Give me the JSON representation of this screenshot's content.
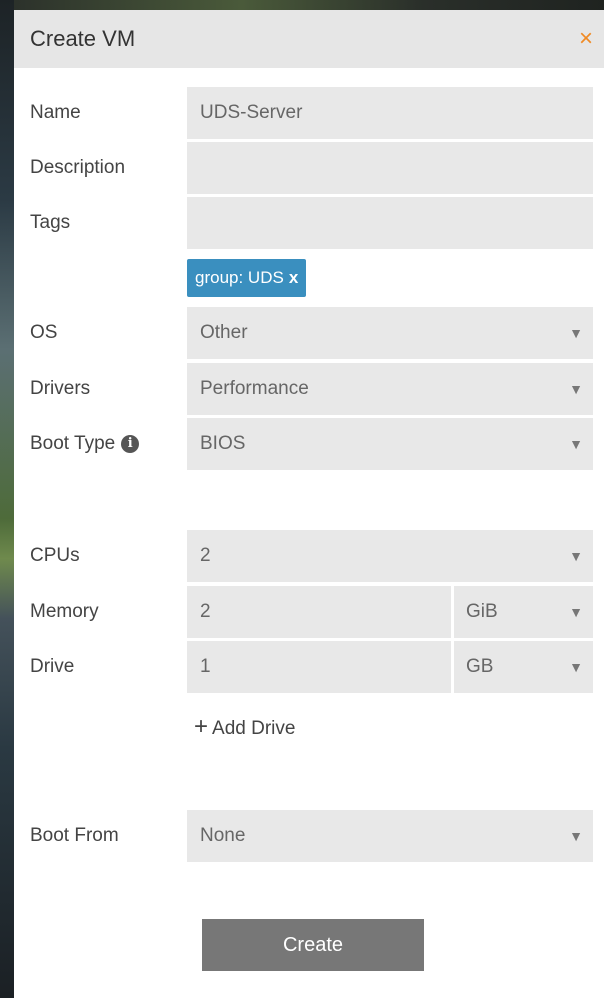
{
  "modal": {
    "title": "Create VM",
    "close_symbol": "×"
  },
  "fields": {
    "name": {
      "label": "Name",
      "value": "UDS-Server"
    },
    "description": {
      "label": "Description",
      "value": ""
    },
    "tags": {
      "label": "Tags",
      "value": "",
      "chips": [
        {
          "text": "group: UDS",
          "remove": "x"
        }
      ]
    },
    "os": {
      "label": "OS",
      "value": "Other"
    },
    "drivers": {
      "label": "Drivers",
      "value": "Performance"
    },
    "boot_type": {
      "label": "Boot Type",
      "value": "BIOS",
      "info_symbol": "i"
    },
    "cpus": {
      "label": "CPUs",
      "value": "2"
    },
    "memory": {
      "label": "Memory",
      "value": "2",
      "unit": "GiB"
    },
    "drive": {
      "label": "Drive",
      "value": "1",
      "unit": "GB"
    },
    "boot_from": {
      "label": "Boot From",
      "value": "None"
    }
  },
  "add_drive": {
    "plus": "+",
    "label": "Add Drive"
  },
  "create_button": {
    "label": "Create"
  },
  "caret_symbol": "▼",
  "colors": {
    "accent_close": "#f08a24",
    "tag_bg": "#3a8fbf",
    "button_bg": "#777777"
  }
}
